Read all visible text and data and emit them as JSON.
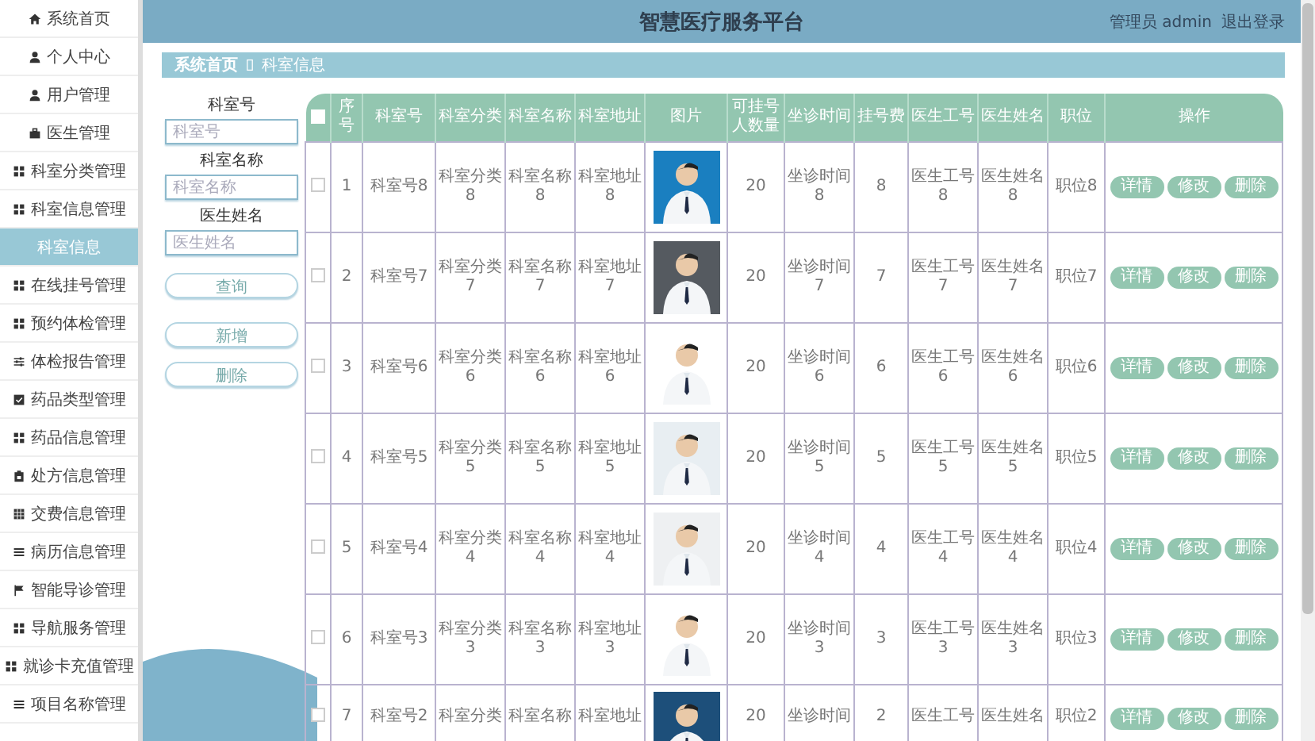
{
  "sidebar": {
    "items": [
      {
        "label": "系统首页",
        "selected": false
      },
      {
        "label": "个人中心",
        "selected": false
      },
      {
        "label": "用户管理",
        "selected": false
      },
      {
        "label": "医生管理",
        "selected": false
      },
      {
        "label": "科室分类管理",
        "selected": false
      },
      {
        "label": "科室信息管理",
        "selected": false
      },
      {
        "label": "科室信息",
        "selected": true
      },
      {
        "label": "在线挂号管理",
        "selected": false
      },
      {
        "label": "预约体检管理",
        "selected": false
      },
      {
        "label": "体检报告管理",
        "selected": false
      },
      {
        "label": "药品类型管理",
        "selected": false
      },
      {
        "label": "药品信息管理",
        "selected": false
      },
      {
        "label": "处方信息管理",
        "selected": false
      },
      {
        "label": "交费信息管理",
        "selected": false
      },
      {
        "label": "病历信息管理",
        "selected": false
      },
      {
        "label": "智能导诊管理",
        "selected": false
      },
      {
        "label": "导航服务管理",
        "selected": false
      },
      {
        "label": "就诊卡充值管理",
        "selected": false
      },
      {
        "label": "项目名称管理",
        "selected": false
      }
    ]
  },
  "header": {
    "title": "智慧医疗服务平台",
    "user": "管理员 admin",
    "logout": "退出登录"
  },
  "breadcrumb": [
    "系统首页",
    "科室信息"
  ],
  "search_form": {
    "fields": [
      {
        "label": "科室号",
        "placeholder": "科室号"
      },
      {
        "label": "科室名称",
        "placeholder": "科室名称"
      },
      {
        "label": "医生姓名",
        "placeholder": "医生姓名"
      }
    ],
    "buttons": [
      "查询",
      "新增",
      "删除"
    ]
  },
  "table": {
    "select_all": {
      "checked": false
    },
    "columns": [
      "序号",
      "科室号",
      "科室分类",
      "科室名称",
      "科室地址",
      "图片",
      "可挂号人数量",
      "坐诊时间",
      "挂号费",
      "医生工号",
      "医生姓名",
      "职位",
      "操作"
    ],
    "rows": [
      {
        "checked": false,
        "cells": [
          "1",
          "科室号8",
          "科室分类8",
          "科室名称8",
          "科室地址8",
          {
            "kind": "picture"
          },
          "20",
          "坐诊时间8",
          "8",
          "医生工号8",
          "医生姓名8",
          "职位8"
        ],
        "actions": [
          "详情",
          "修改",
          "删除"
        ]
      },
      {
        "checked": false,
        "cells": [
          "2",
          "科室号7",
          "科室分类7",
          "科室名称7",
          "科室地址7",
          {
            "kind": "picture"
          },
          "20",
          "坐诊时间7",
          "7",
          "医生工号7",
          "医生姓名7",
          "职位7"
        ],
        "actions": [
          "详情",
          "修改",
          "删除"
        ]
      },
      {
        "checked": false,
        "cells": [
          "3",
          "科室号6",
          "科室分类6",
          "科室名称6",
          "科室地址6",
          {
            "kind": "picture"
          },
          "20",
          "坐诊时间6",
          "6",
          "医生工号6",
          "医生姓名6",
          "职位6"
        ],
        "actions": [
          "详情",
          "修改",
          "删除"
        ]
      },
      {
        "checked": false,
        "cells": [
          "4",
          "科室号5",
          "科室分类5",
          "科室名称5",
          "科室地址5",
          {
            "kind": "picture"
          },
          "20",
          "坐诊时间5",
          "5",
          "医生工号5",
          "医生姓名5",
          "职位5"
        ],
        "actions": [
          "详情",
          "修改",
          "删除"
        ]
      },
      {
        "checked": false,
        "cells": [
          "5",
          "科室号4",
          "科室分类4",
          "科室名称4",
          "科室地址4",
          {
            "kind": "picture"
          },
          "20",
          "坐诊时间4",
          "4",
          "医生工号4",
          "医生姓名4",
          "职位4"
        ],
        "actions": [
          "详情",
          "修改",
          "删除"
        ]
      },
      {
        "checked": false,
        "cells": [
          "6",
          "科室号3",
          "科室分类3",
          "科室名称3",
          "科室地址3",
          {
            "kind": "picture"
          },
          "20",
          "坐诊时间3",
          "3",
          "医生工号3",
          "医生姓名3",
          "职位3"
        ],
        "actions": [
          "详情",
          "修改",
          "删除"
        ]
      },
      {
        "checked": false,
        "cells": [
          "7",
          "科室号2",
          "科室分类",
          "科室名称",
          "科室地址",
          {
            "kind": "picture"
          },
          "20",
          "坐诊时间",
          "2",
          "医生工号",
          "医生姓名",
          "职位2"
        ],
        "actions": [
          "详情",
          "修改",
          "删除"
        ]
      }
    ]
  }
}
